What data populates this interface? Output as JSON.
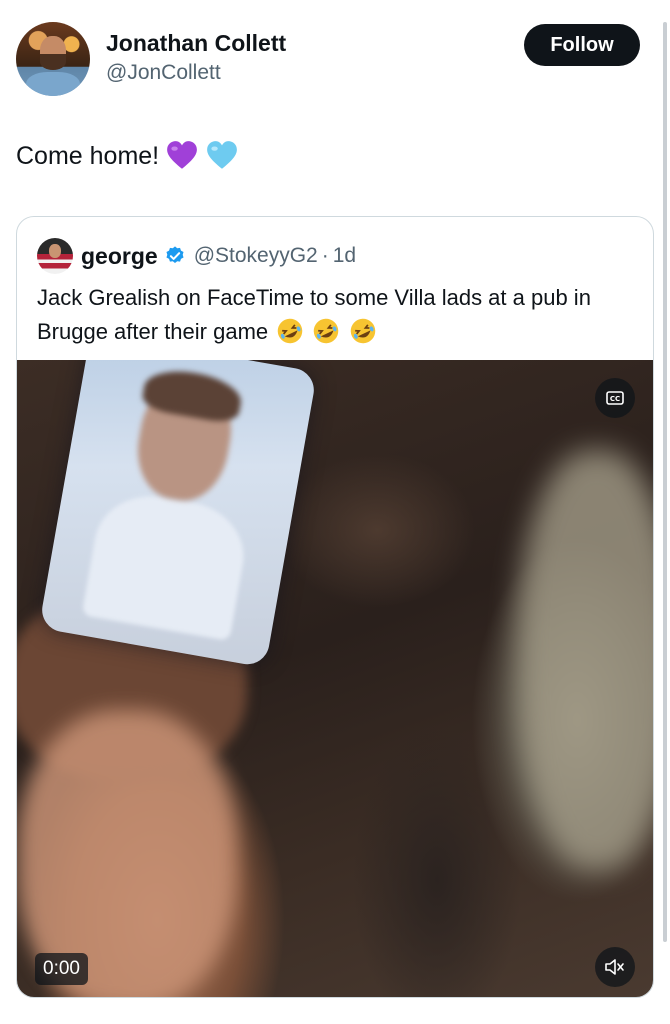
{
  "author": {
    "display_name": "Jonathan Collett",
    "handle": "@JonCollett",
    "avatar_icon": "profile-photo"
  },
  "follow_label": "Follow",
  "tweet": {
    "text": "Come home!",
    "emojis": [
      "purple-heart",
      "light-blue-heart"
    ]
  },
  "quoted": {
    "display_name": "george",
    "verified": true,
    "handle": "@StokeyyG2",
    "separator": "·",
    "time": "1d",
    "text": "Jack Grealish on FaceTime to some Villa lads at a pub in Brugge after their game",
    "emojis": [
      "rolling-on-floor-laughing",
      "rolling-on-floor-laughing",
      "rolling-on-floor-laughing"
    ]
  },
  "video": {
    "time": "0:00",
    "captions_icon": "cc-icon",
    "mute_icon": "muted-speaker-icon"
  },
  "colors": {
    "accent_verified": "#1d9bf0",
    "follow_bg": "#0f1419",
    "secondary_text": "#536471",
    "heart_purple": "#a040d8",
    "heart_blue": "#6ecbf0"
  }
}
